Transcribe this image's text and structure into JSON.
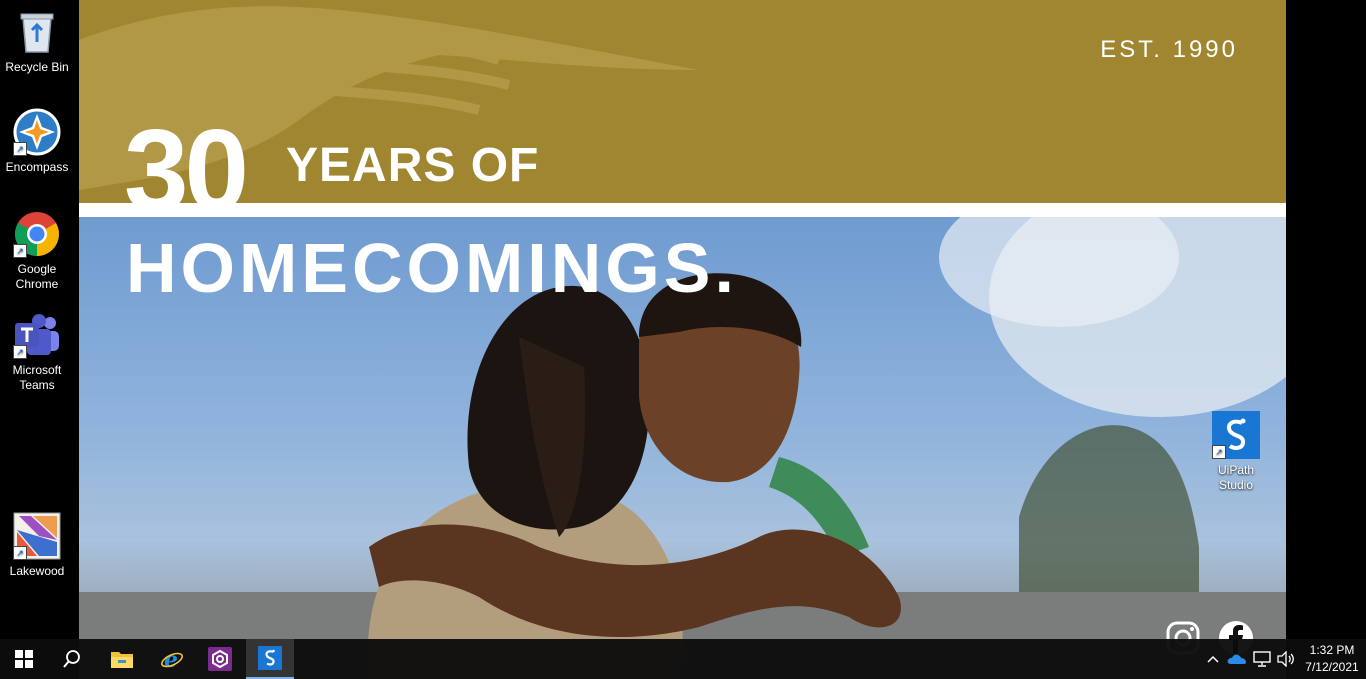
{
  "desktop": {
    "icons": [
      {
        "label": "Recycle Bin",
        "icon": "recycle-bin-icon"
      },
      {
        "label": "Encompass",
        "icon": "encompass-icon"
      },
      {
        "label": "Google Chrome",
        "icon": "chrome-icon"
      },
      {
        "label": "Microsoft Teams",
        "icon": "teams-icon"
      },
      {
        "label": "Lakewood",
        "icon": "lakewood-icon"
      },
      {
        "label": "UiPath Studio",
        "icon": "uipath-icon"
      }
    ]
  },
  "wallpaper": {
    "est": "EST. 1990",
    "big_number": "30",
    "line1": "YEARS OF",
    "line2": "HOMECOMINGS.",
    "social": [
      "instagram-icon",
      "facebook-icon"
    ],
    "colors": {
      "gold": "#a08630",
      "sky": "#7fa3cf"
    }
  },
  "taskbar": {
    "pinned": [
      "windows-start-icon",
      "search-icon",
      "file-explorer-icon",
      "internet-explorer-icon",
      "app-purple-icon",
      "uipath-icon"
    ],
    "tray_icons": [
      "chevron-up-icon",
      "onedrive-icon",
      "network-icon",
      "volume-icon"
    ],
    "time": "1:32 PM",
    "date": "7/12/2021"
  }
}
